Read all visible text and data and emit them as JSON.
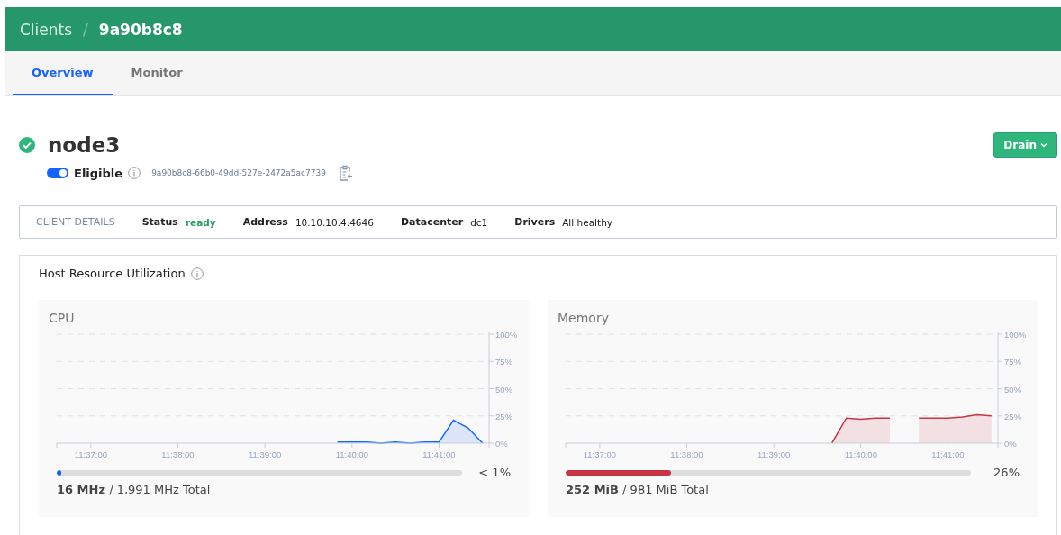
{
  "breadcrumb": [
    {
      "label": "Clients"
    },
    {
      "label": "9a90b8c8"
    }
  ],
  "breadcrumb_separator": "/",
  "tabs": [
    {
      "label": "Overview",
      "selected": true
    },
    {
      "label": "Monitor",
      "selected": false
    }
  ],
  "node": {
    "name": "node3",
    "status_ok": true,
    "eligible": true,
    "eligible_label": "Eligible",
    "id": "9a90b8c8-66b0-49dd-527e-2472a5ac7739"
  },
  "drain_button": {
    "label": "Drain"
  },
  "client_details": {
    "title": "CLIENT DETAILS",
    "items": [
      {
        "label": "Status",
        "value": "ready",
        "kind": "status"
      },
      {
        "label": "Address",
        "value": "10.10.10.4:4646",
        "kind": "plain"
      },
      {
        "label": "Datacenter",
        "value": "dc1",
        "kind": "plain"
      },
      {
        "label": "Drivers",
        "value": "All healthy",
        "kind": "plain"
      }
    ]
  },
  "utilization": {
    "title": "Host Resource Utilization",
    "panels": [
      {
        "color": "#1563ff",
        "level": 0.01,
        "percent": "< 1%",
        "used": "16 MHz",
        "total": "/ 1,991 MHz Total",
        "chart_data": {
          "type": "area",
          "grid": true,
          "ylim": [
            0,
            100
          ],
          "categories": [
            null,
            null,
            "11:37:00",
            null,
            null,
            null,
            null,
            null,
            "11:38:00",
            null,
            null,
            null,
            null,
            null,
            "11:39:00",
            null,
            null,
            null,
            null,
            null,
            "11:40:00",
            null,
            null,
            null,
            null,
            null,
            "11:41:00",
            null,
            null,
            null
          ],
          "yticks": [
            {
              "value": 0,
              "label": "0%"
            },
            {
              "value": 25,
              "label": "25%"
            },
            {
              "value": 50,
              "label": "50%"
            },
            {
              "value": 75,
              "label": "75%"
            },
            {
              "value": 100,
              "label": "100%"
            }
          ],
          "series": [
            {
              "name": "CPU",
              "color": "#1563ff",
              "values": [
                null,
                null,
                null,
                null,
                null,
                null,
                null,
                null,
                null,
                null,
                null,
                null,
                null,
                null,
                null,
                null,
                null,
                null,
                null,
                1,
                1,
                1,
                0,
                1,
                0,
                1,
                1,
                21,
                14,
                0
              ]
            }
          ]
        }
      },
      {
        "color": "#c73445",
        "level": 0.26,
        "percent": "26%",
        "used": "252 MiB",
        "total": "/ 981 MiB Total",
        "chart_data": {
          "type": "area",
          "grid": true,
          "ylim": [
            0,
            100
          ],
          "categories": [
            null,
            null,
            "11:37:00",
            null,
            null,
            null,
            null,
            null,
            "11:38:00",
            null,
            null,
            null,
            null,
            null,
            "11:39:00",
            null,
            null,
            null,
            null,
            null,
            "11:40:00",
            null,
            null,
            null,
            null,
            null,
            "11:41:00",
            null,
            null,
            null
          ],
          "yticks": [
            {
              "value": 0,
              "label": "0%"
            },
            {
              "value": 25,
              "label": "25%"
            },
            {
              "value": 50,
              "label": "50%"
            },
            {
              "value": 75,
              "label": "75%"
            },
            {
              "value": 100,
              "label": "100%"
            }
          ],
          "series": [
            {
              "name": "Memory",
              "color": "#c73445",
              "values": [
                null,
                null,
                null,
                null,
                null,
                null,
                null,
                null,
                null,
                null,
                null,
                null,
                null,
                null,
                null,
                null,
                null,
                null,
                0,
                23,
                22,
                23,
                23,
                null,
                23,
                23,
                23,
                24,
                26,
                25
              ]
            }
          ]
        }
      }
    ]
  }
}
